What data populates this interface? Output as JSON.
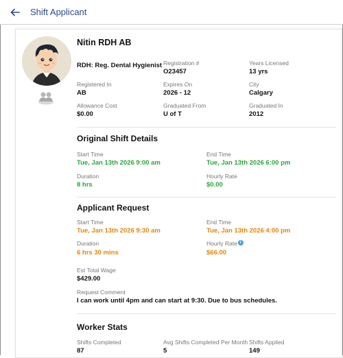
{
  "header": {
    "title": "Shift Applicant"
  },
  "profile": {
    "name": "Nitin RDH AB",
    "role": "RDH: Reg. Dental Hygienist",
    "fields": [
      {
        "label": "Registration #",
        "value": "O23457"
      },
      {
        "label": "Years Licensed",
        "value": "13 yrs"
      },
      {
        "label": "Registered In",
        "value": "AB"
      },
      {
        "label": "Expires On",
        "value": "2026 - 12"
      },
      {
        "label": "City",
        "value": "Calgary"
      },
      {
        "label": "Allowance Cost",
        "value": "$0.00"
      },
      {
        "label": "Graduated From",
        "value": "U of T"
      },
      {
        "label": "Graduated In",
        "value": "2012"
      }
    ]
  },
  "original_shift": {
    "title": "Original Shift Details",
    "start_label": "Start Time",
    "start_value": "Tue, Jan 13th 2026 9:00 am",
    "end_label": "End Time",
    "end_value": "Tue, Jan 13th 2026 6:00 pm",
    "duration_label": "Duration",
    "duration_value": "8 hrs",
    "rate_label": "Hourly Rate",
    "rate_value": "$0.00"
  },
  "applicant_request": {
    "title": "Applicant Request",
    "start_label": "Start Time",
    "start_value": "Tue, Jan 13th 2026 9:30 am",
    "end_label": "End Time",
    "end_value": "Tue, Jan 13th 2026 4:00 pm",
    "duration_label": "Duration",
    "duration_value": "6 hrs 30 mins",
    "rate_label": "Hourly Rate",
    "rate_value": "$66.00",
    "info_glyph": "i",
    "wage_label": "Est Total Wage",
    "wage_value": "$429.00",
    "comment_label": "Request Comment",
    "comment_value": "I can work until 4pm and can start at 9:30. Due to bus schedules."
  },
  "worker_stats": {
    "title": "Worker Stats",
    "completed_label": "Shifts Completed",
    "completed_value": "87",
    "avg_label": "Avg Shifts Completed Per Month",
    "avg_value": "5",
    "applied_label": "Shifts Applied",
    "applied_value": "149"
  },
  "colors": {
    "accent": "#2a4a8a",
    "green": "#2aa63a",
    "orange": "#e4860c"
  },
  "icons": {
    "back": "arrow-left-icon",
    "group": "people-group-icon"
  }
}
